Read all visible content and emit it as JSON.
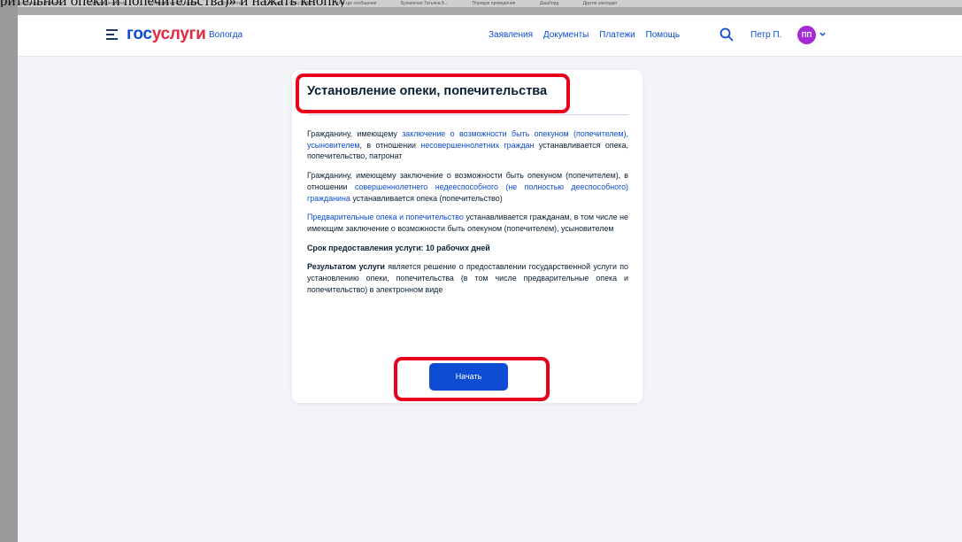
{
  "caption": "рительной опеки и попечительства)» и нажать кнопку",
  "bookmarks": [
    "Бухаичная Татьяна Б...",
    "Консультант плюс",
    "Корпоративный портал",
    "Консента",
    "Главная — ФНЦ ОНКО",
    "Что где сеобщение",
    "Бухаичная Татьяна Б...",
    "Порядок проведения",
    "Дашборд",
    "Другие закладки"
  ],
  "header": {
    "logo_part1": "гос",
    "logo_part2": "услуги",
    "city": "Вологда",
    "nav": [
      "Заявления",
      "Документы",
      "Платежи",
      "Помощь"
    ],
    "user_name": "Петр П.",
    "avatar_initials": "ПП",
    "icons": {
      "menu": "burger-menu-icon",
      "search": "search-icon",
      "dropdown": "chevron-down-icon"
    }
  },
  "card": {
    "title": "Установление опеки, попечительства",
    "p1": {
      "t1": "Гражданину, имеющему ",
      "l1": "заключение о возможности быть опекуном (попечителем), усыновителем",
      "t2": ", в отношении ",
      "l2": "несовершеннолетних граждан",
      "t3": " устанавливается опека, попечительство, патронат"
    },
    "p2": {
      "t1": "Гражданину, имеющему заключение о возможности быть опекуном (попечителем), в отношении ",
      "l1": "совершеннолетнего недееспособного (не полностью дееспособного) гражданина",
      "t2": " устанавливается опека (попечительство)"
    },
    "p3": {
      "l1": "Предварительные опека и попечительство",
      "t1": " устанавливается гражданам, в том числе не имеющим заключение о возможности быть опекуном (попечителем), усыновителем"
    },
    "term": "Срок предоставления услуги: 10 рабочих дней",
    "p5": {
      "b1": "Результатом услуги",
      "t1": " является решение о предоставлении государственной услуги по установлению опеки, попечительства (в том числе предварительные опека и попечительство) в электронном виде"
    },
    "start_button": "Начать"
  },
  "colors": {
    "brand_blue": "#0d4cd3",
    "brand_red": "#e1283f",
    "annotation_red": "#e8001c",
    "avatar": "#a52bd6"
  }
}
